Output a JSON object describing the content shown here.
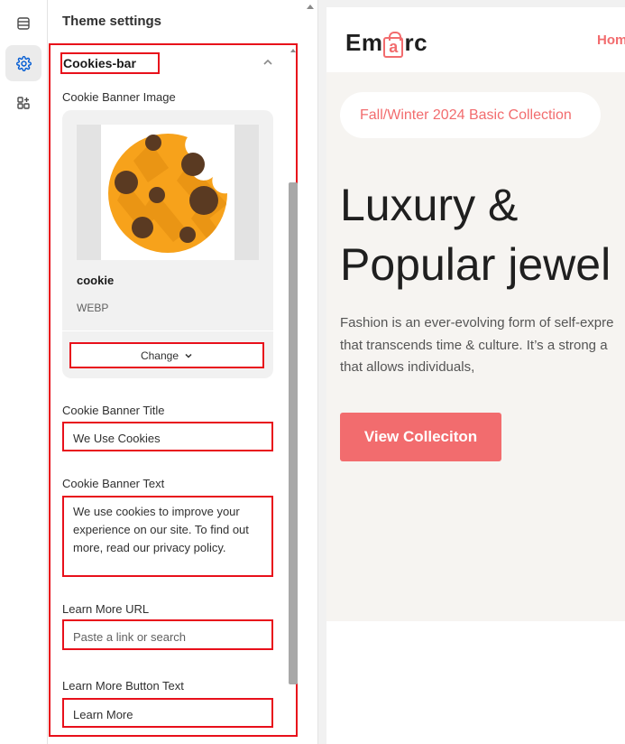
{
  "panel": {
    "title": "Theme settings",
    "section_title": "Cookies-bar",
    "image_label": "Cookie Banner Image",
    "image_file_name": "cookie",
    "image_file_type": "WEBP",
    "change_button": "Change",
    "title_label": "Cookie Banner Title",
    "title_value": "We Use Cookies",
    "text_label": "Cookie Banner Text",
    "text_value": "We use cookies to improve your experience on our site. To find out more, read our privacy policy.",
    "url_label": "Learn More URL",
    "url_placeholder": "Paste a link or search",
    "button_text_label": "Learn More Button Text",
    "button_text_value": "Learn More"
  },
  "preview": {
    "logo_left": "Em",
    "logo_bag_letter": "a",
    "logo_right": "rc",
    "nav_link": "Hom",
    "pill_text": "Fall/Winter 2024 Basic Collection",
    "headline_line1": "Luxury &",
    "headline_line2": "Popular jewel",
    "desc_line1": "Fashion is an ever-evolving form of self-expre",
    "desc_line2": "that transcends time & culture. It’s a strong a",
    "desc_line3": "that allows individuals,",
    "cta": "View Colleciton"
  },
  "colors": {
    "accent": "#f26c6e",
    "highlight_border": "#e8101b",
    "settings_icon": "#005bd3"
  },
  "icons": {
    "rail": [
      "sections-icon",
      "settings-gear-icon",
      "apps-icon"
    ],
    "section": "chevron-up-icon",
    "change": "chevron-down-icon"
  }
}
